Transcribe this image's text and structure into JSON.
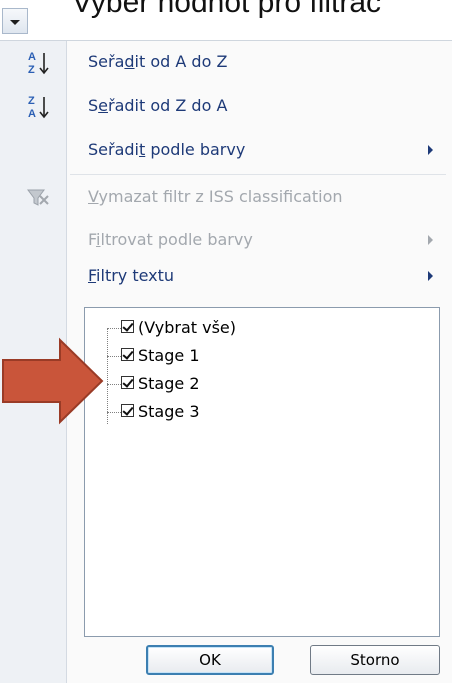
{
  "caption": {
    "text": "Vyber hodnot pro filtrac"
  },
  "menu": {
    "items": [
      {
        "pre": "Seřa",
        "accel": "d",
        "post": "it od A do Z",
        "icon": "sort-a-to-z-icon",
        "enabled": true,
        "submenu": false
      },
      {
        "pre": "S",
        "accel": "e",
        "post": "řadit od Z do A",
        "icon": "sort-z-to-a-icon",
        "enabled": true,
        "submenu": false
      },
      {
        "pre": "Seřadi",
        "accel": "t",
        "post": " podle barvy",
        "icon": "",
        "enabled": true,
        "submenu": true
      },
      {
        "pre": "",
        "accel": "V",
        "post": "ymazat filtr z ISS classification",
        "icon": "clear-filter-icon",
        "enabled": false,
        "submenu": false
      },
      {
        "pre": "F",
        "accel": "i",
        "post": "ltrovat podle barvy",
        "icon": "",
        "enabled": false,
        "submenu": true
      },
      {
        "pre": "",
        "accel": "F",
        "post": "iltry textu",
        "icon": "",
        "enabled": true,
        "submenu": true
      }
    ],
    "sort_icon_letters": {
      "top_a": "A",
      "bottom_z": "Z",
      "top_z": "Z",
      "bottom_a": "A"
    }
  },
  "values_list": {
    "items": [
      {
        "label": "(Vybrat vše)",
        "checked": true
      },
      {
        "label": "Stage 1",
        "checked": true
      },
      {
        "label": "Stage 2",
        "checked": true
      },
      {
        "label": "Stage 3",
        "checked": true
      }
    ]
  },
  "buttons": {
    "ok": "OK",
    "cancel": "Storno"
  },
  "colors": {
    "menu_text": "#1e3a78",
    "disabled_text": "#a3a8ae",
    "arrow_fill": "#c9553a",
    "arrow_stroke": "#9a3b26"
  }
}
